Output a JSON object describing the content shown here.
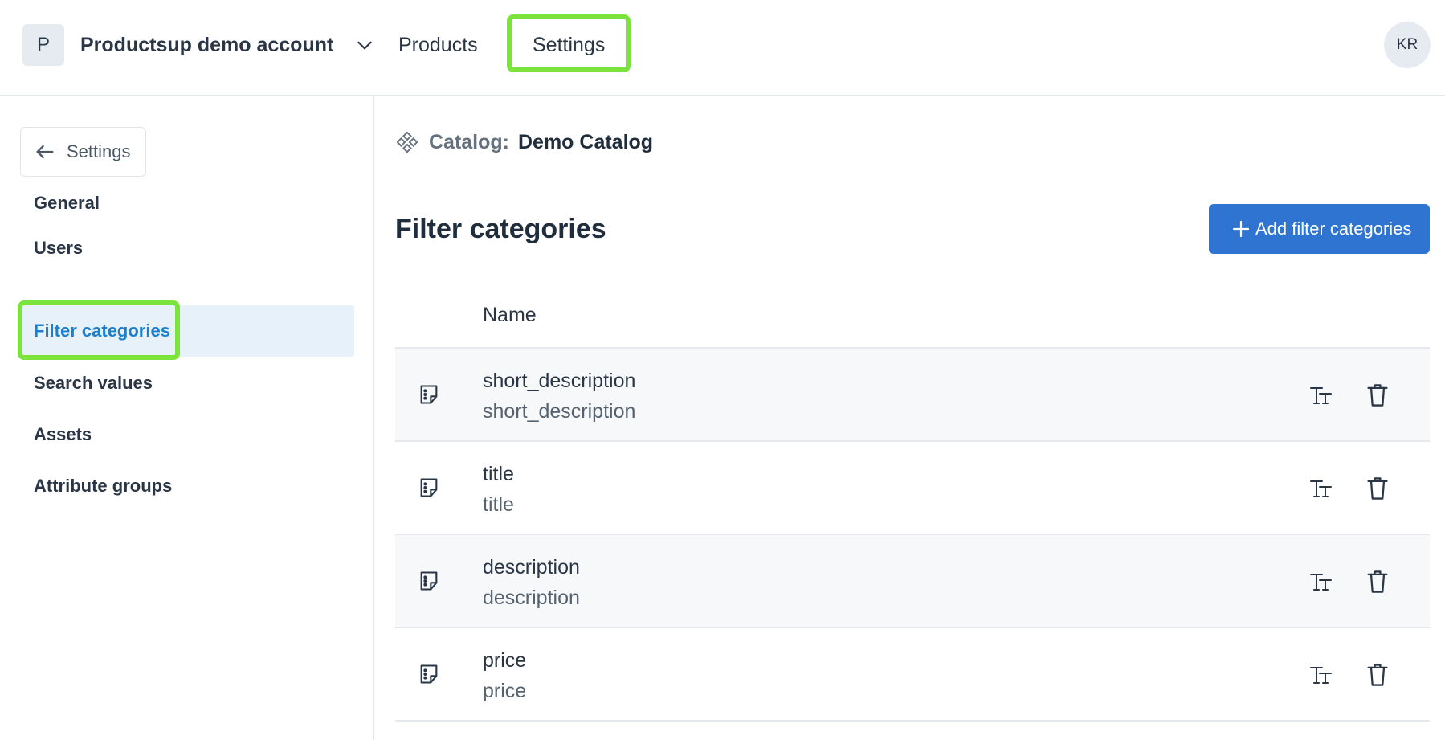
{
  "header": {
    "account_initial": "P",
    "account_name": "Productsup demo account",
    "nav": {
      "products": "Products",
      "settings": "Settings"
    },
    "user_initials": "KR"
  },
  "sidebar": {
    "back_label": "Settings",
    "items": [
      {
        "label": "General",
        "active": false
      },
      {
        "label": "Users",
        "active": false
      },
      {
        "label": "Filter categories",
        "active": true
      },
      {
        "label": "Search values",
        "active": false
      },
      {
        "label": "Assets",
        "active": false
      },
      {
        "label": "Attribute groups",
        "active": false
      }
    ]
  },
  "main": {
    "catalog": {
      "label": "Catalog:",
      "value": "Demo Catalog"
    },
    "title": "Filter categories",
    "add_button_label": "Add filter categories",
    "table": {
      "column_name": "Name",
      "rows": [
        {
          "title": "short_description",
          "subtitle": "short_description"
        },
        {
          "title": "title",
          "subtitle": "title"
        },
        {
          "title": "description",
          "subtitle": "description"
        },
        {
          "title": "price",
          "subtitle": "price"
        }
      ]
    }
  },
  "colors": {
    "accent": "#2f74d0",
    "active_text": "#1d7fcc",
    "active_bg": "#e6f1fa",
    "highlight": "#7be33c"
  },
  "icons": [
    "chevron-down-icon",
    "arrow-left-icon",
    "catalog-icon",
    "plus-icon",
    "note-icon",
    "text-size-icon",
    "trash-icon"
  ]
}
